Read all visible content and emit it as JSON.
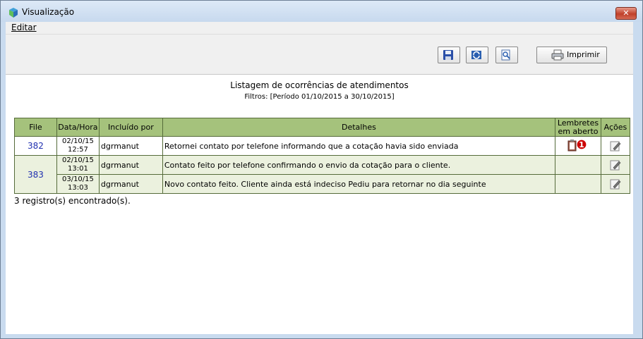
{
  "window": {
    "title": "Visualização",
    "close_label": "✕"
  },
  "menu": {
    "items": [
      {
        "label": "Editar"
      }
    ]
  },
  "toolbar": {
    "print_label": "Imprimir"
  },
  "report": {
    "title": "Listagem de ocorrências de atendimentos",
    "filter": "Filtros: [Período 01/10/2015 a 30/10/2015]"
  },
  "table": {
    "headers": {
      "file": "File",
      "datetime": "Data/Hora",
      "included_by": "Incluído por",
      "details": "Detalhes",
      "reminders_line1": "Lembretes",
      "reminders_line2": "em aberto",
      "actions": "Ações"
    },
    "rows": [
      {
        "file": "382",
        "date": "02/10/15",
        "time": "12:57",
        "user": "dgrmanut",
        "details": "Retornei contato por telefone informando que a cotação havia sido enviada",
        "reminders": "1"
      },
      {
        "file": "383",
        "date": "02/10/15",
        "time": "13:01",
        "user": "dgrmanut",
        "details": "Contato feito por telefone confirmando o envio da cotação para o cliente.",
        "reminders": ""
      },
      {
        "file": "",
        "date": "03/10/15",
        "time": "13:03",
        "user": "dgrmanut",
        "details": "Novo contato feito. Cliente ainda está indeciso Pediu para retornar no dia seguinte",
        "reminders": ""
      }
    ]
  },
  "footer": {
    "count_text": "3 registro(s) encontrado(s)."
  },
  "icons": {
    "save": "save-icon",
    "refresh": "refresh-icon",
    "preview": "zoom-preview-icon",
    "print": "printer-icon",
    "reminder": "clipboard-alert-icon",
    "edit": "edit-icon"
  },
  "colors": {
    "header_bg": "#a5c27c",
    "row_alt_bg": "#ebf1de",
    "file_link": "#2030b0",
    "badge_red": "#cc0000"
  }
}
